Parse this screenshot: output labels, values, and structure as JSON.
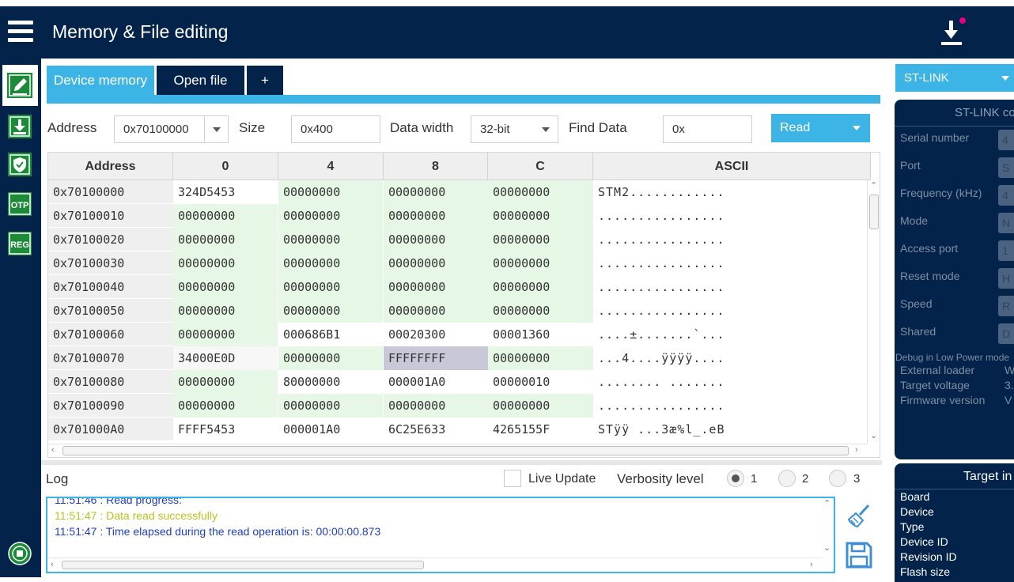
{
  "app": {
    "title": "Memory & File editing"
  },
  "icons": {
    "menu": "hamburger-menu-icon",
    "download": "download-icon",
    "sidebar": [
      "edit-memory-icon",
      "erase-program-icon",
      "security-shield-icon",
      "otp-icon",
      "reg-icon"
    ],
    "sidebar_otp_text": "OTP",
    "sidebar_reg_text": "REG",
    "bottom": "logo-badge-icon"
  },
  "tabs": [
    {
      "label": "Device memory"
    },
    {
      "label": "Open file"
    },
    {
      "label": "+"
    }
  ],
  "toolbar": {
    "address_label": "Address",
    "address_value": "0x70100000",
    "size_label": "Size",
    "size_value": "0x400",
    "data_width_label": "Data width",
    "data_width_value": "32-bit",
    "find_label": "Find Data",
    "find_value": "0x",
    "read_label": "Read"
  },
  "grid": {
    "headers": [
      "Address",
      "0",
      "4",
      "8",
      "C",
      "ASCII"
    ],
    "rows": [
      {
        "addr": "0x70100000",
        "c0": "324D5453",
        "c4": "00000000",
        "c8": "00000000",
        "cC": "00000000",
        "ascii": "STM2............"
      },
      {
        "addr": "0x70100010",
        "c0": "00000000",
        "c4": "00000000",
        "c8": "00000000",
        "cC": "00000000",
        "ascii": "................"
      },
      {
        "addr": "0x70100020",
        "c0": "00000000",
        "c4": "00000000",
        "c8": "00000000",
        "cC": "00000000",
        "ascii": "................"
      },
      {
        "addr": "0x70100030",
        "c0": "00000000",
        "c4": "00000000",
        "c8": "00000000",
        "cC": "00000000",
        "ascii": "................"
      },
      {
        "addr": "0x70100040",
        "c0": "00000000",
        "c4": "00000000",
        "c8": "00000000",
        "cC": "00000000",
        "ascii": "................"
      },
      {
        "addr": "0x70100050",
        "c0": "00000000",
        "c4": "00000000",
        "c8": "00000000",
        "cC": "00000000",
        "ascii": "................"
      },
      {
        "addr": "0x70100060",
        "c0": "00000000",
        "c4": "000686B1",
        "c8": "00020300",
        "cC": "00001360",
        "ascii": "....±.......`..."
      },
      {
        "addr": "0x70100070",
        "c0": "34000E0D",
        "c4": "00000000",
        "c8": "FFFFFFFF",
        "cC": "00000000",
        "ascii": "...4....ÿÿÿÿ...."
      },
      {
        "addr": "0x70100080",
        "c0": "00000000",
        "c4": "80000000",
        "c8": "000001A0",
        "cC": "00000010",
        "ascii": "........ ......."
      },
      {
        "addr": "0x70100090",
        "c0": "00000000",
        "c4": "00000000",
        "c8": "00000000",
        "cC": "00000000",
        "ascii": "................"
      },
      {
        "addr": "0x701000A0",
        "c0": "FFFF5453",
        "c4": "000001A0",
        "c8": "6C25E633",
        "cC": "4265155F",
        "ascii": "STÿÿ ...3æ%l_.eB"
      }
    ]
  },
  "log": {
    "label": "Log",
    "live_update_label": "Live Update",
    "verbosity_label": "Verbosity level",
    "verbosity_options": [
      "1",
      "2",
      "3"
    ],
    "verbosity_selected": "1",
    "lines": [
      {
        "text": "11:51:46 : Read progress:",
        "color": "#1f3fbf"
      },
      {
        "text": "11:51:47 : Data read successfully",
        "color": "#b8c41e"
      },
      {
        "text": "11:51:47 : Time elapsed during the read operation is: 00:00:00.873",
        "color": "#1f3fbf"
      }
    ]
  },
  "stlink": {
    "combo_label": "ST-LINK",
    "panel_title": "ST-LINK co",
    "fields": [
      {
        "label": "Serial number",
        "value": "4"
      },
      {
        "label": "Port",
        "value": "S"
      },
      {
        "label": "Frequency (kHz)",
        "value": "4"
      },
      {
        "label": "Mode",
        "value": "N"
      },
      {
        "label": "Access port",
        "value": "1"
      },
      {
        "label": "Reset mode",
        "value": "H"
      },
      {
        "label": "Speed",
        "value": "R"
      },
      {
        "label": "Shared",
        "value": "D"
      }
    ],
    "debug_low_power": "Debug in Low Power mode",
    "info": [
      {
        "label": "External loader",
        "value": "W"
      },
      {
        "label": "Target voltage",
        "value": "3."
      },
      {
        "label": "Firmware version",
        "value": "V"
      }
    ]
  },
  "target": {
    "title": "Target in",
    "items": [
      "Board",
      "Device",
      "Type",
      "Device ID",
      "Revision ID",
      "Flash size"
    ]
  },
  "colors": {
    "navy": "#03234b",
    "accent": "#3cb4e6",
    "row_green": "#e6f7e6",
    "selected": "#c8c8d8"
  }
}
